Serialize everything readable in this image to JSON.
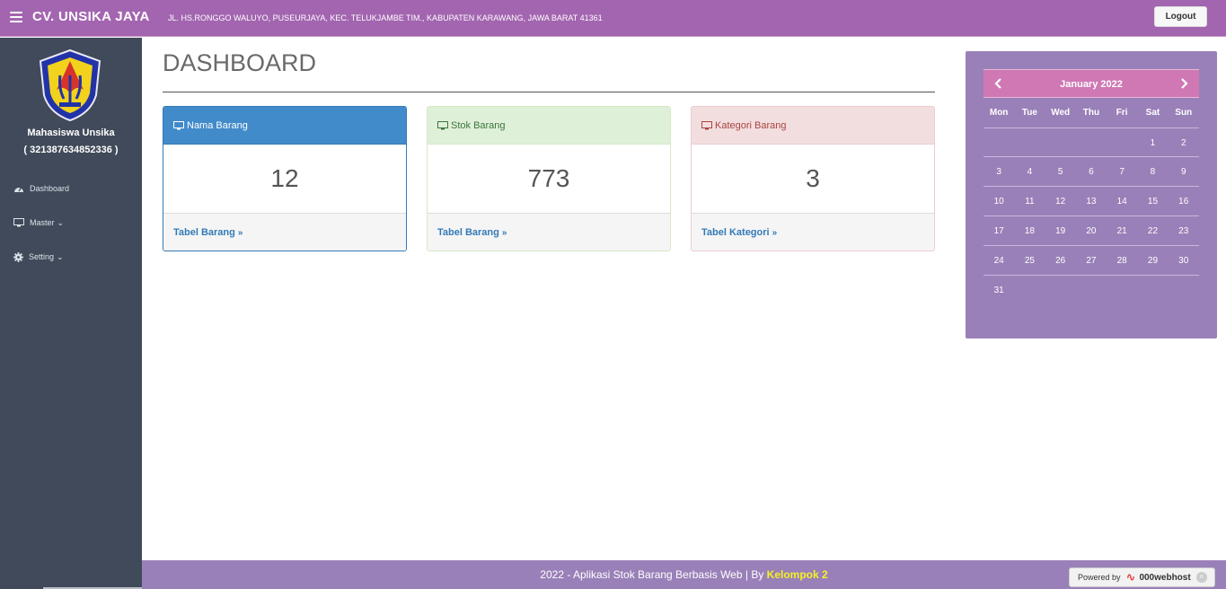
{
  "navbar": {
    "menu_icon": "hamburger-icon",
    "brand": "CV. UNSIKA JAYA",
    "address": "JL. HS.RONGGO WALUYO, PUSEURJAYA, KEC. TELUKJAMBE TIM., KABUPATEN KARAWANG, JAWA BARAT 41361",
    "logout_label": "Logout"
  },
  "sidebar": {
    "user_name": "Mahasiswa Unsika",
    "user_id": "( 321387634852336 )",
    "items": [
      {
        "label": "Dashboard",
        "icon": "dashboard-icon"
      },
      {
        "label": "Master",
        "icon": "monitor-icon"
      },
      {
        "label": "Setting",
        "icon": "gear-icon"
      }
    ]
  },
  "main": {
    "title": "DASHBOARD",
    "panels": [
      {
        "heading": "Nama Barang",
        "value": "12",
        "link": "Tabel Barang",
        "icon": "monitor-icon",
        "accent": "#428bca"
      },
      {
        "heading": "Stok Barang",
        "value": "773",
        "link": "Tabel Barang",
        "icon": "monitor-icon",
        "accent": "#dff0d8"
      },
      {
        "heading": "Kategori Barang",
        "value": "3",
        "link": "Tabel Kategori",
        "icon": "monitor-icon",
        "accent": "#f2dede"
      }
    ]
  },
  "calendar": {
    "month": "January 2022",
    "weekdays": [
      "Mon",
      "Tue",
      "Wed",
      "Thu",
      "Fri",
      "Sat",
      "Sun"
    ],
    "weeks": [
      [
        "",
        "",
        "",
        "",
        "",
        "1",
        "2"
      ],
      [
        "3",
        "4",
        "5",
        "6",
        "7",
        "8",
        "9"
      ],
      [
        "10",
        "11",
        "12",
        "13",
        "14",
        "15",
        "16"
      ],
      [
        "17",
        "18",
        "19",
        "20",
        "21",
        "22",
        "23"
      ],
      [
        "24",
        "25",
        "26",
        "27",
        "28",
        "29",
        "30"
      ],
      [
        "31",
        "",
        "",
        "",
        "",
        "",
        ""
      ]
    ]
  },
  "footer": {
    "text": "2022 - Aplikasi Stok Barang Berbasis Web | By",
    "group": "Kelompok 2",
    "powered_by": "Powered by",
    "host": "000webhost"
  },
  "colors": {
    "navbar": "#a365b0",
    "sidebar": "#404a5a",
    "calendar": "#9a80b8",
    "calendar_header": "#cf78b4",
    "footer": "#9a80b8"
  }
}
